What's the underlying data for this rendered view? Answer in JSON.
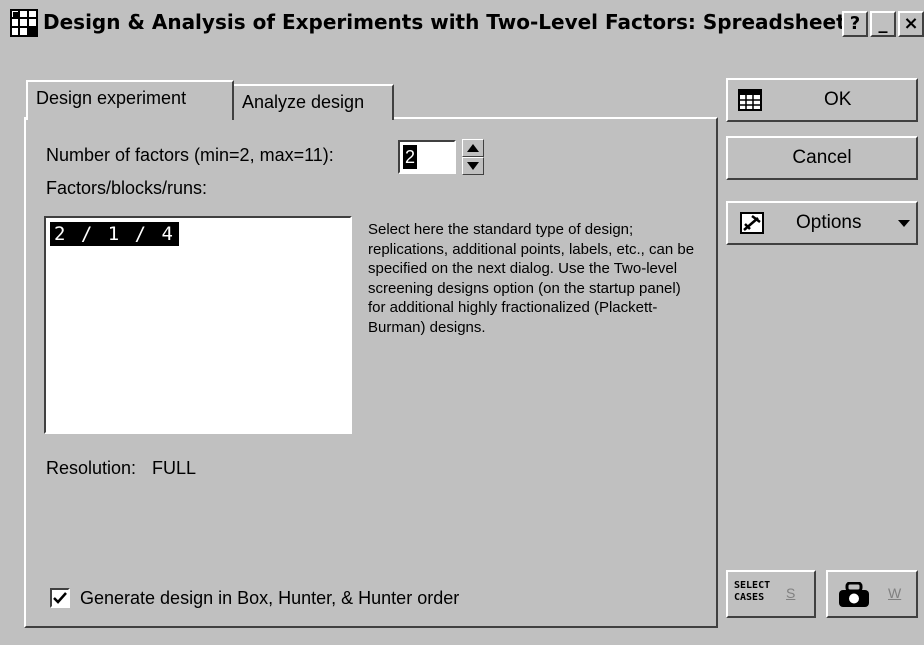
{
  "window": {
    "title": "Design & Analysis of Experiments with Two-Level Factors: Spreadsheet",
    "help_label": "?",
    "minimize_label": "_",
    "close_label": "×"
  },
  "tabs": [
    {
      "label": "Design experiment",
      "active": true
    },
    {
      "label": "Analyze design",
      "active": false
    }
  ],
  "design": {
    "factors_label": "Number of factors (min=2, max=11):",
    "factors_value": "2",
    "list_label": "Factors/blocks/runs:",
    "list_items": [
      "2 / 1 / 4"
    ],
    "description": "Select here the standard type of design; replications, additional points, labels, etc., can be specified on the next dialog. Use the Two-level screening designs option (on the startup panel) for additional highly fractionalized (Plackett-Burman) designs.",
    "resolution_label": "Resolution:",
    "resolution_value": "FULL",
    "bhh_order_label": "Generate design in Box, Hunter, & Hunter order",
    "bhh_order_checked": true
  },
  "buttons": {
    "ok": "OK",
    "cancel": "Cancel",
    "options": "Options",
    "select_cases_line1": "SELECT",
    "select_cases_line2": "CASES",
    "select_cases_key": "S",
    "weight_key": "W"
  }
}
